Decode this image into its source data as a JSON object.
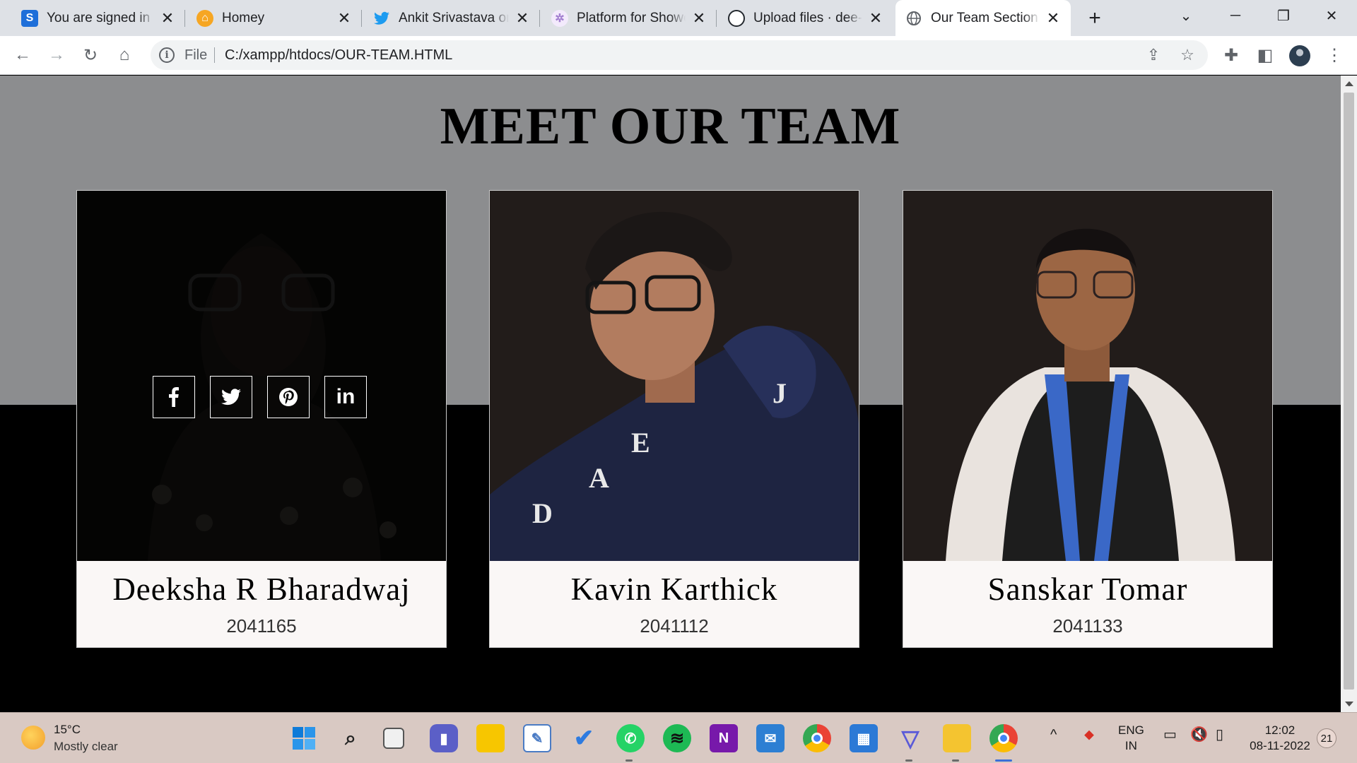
{
  "browser": {
    "tabs": [
      {
        "title": "You are signed in as",
        "favicon": "S",
        "favicon_color": "#1e6fd9"
      },
      {
        "title": "Homey",
        "favicon": "⌂",
        "favicon_color": "#f6a623"
      },
      {
        "title": "Ankit Srivastava on",
        "favicon": "🐦",
        "favicon_color": "#1d9bf0"
      },
      {
        "title": "Platform for Showc",
        "favicon": "✲",
        "favicon_color": "#c7a6e8"
      },
      {
        "title": "Upload files · dee-s",
        "favicon": "●",
        "favicon_color": "#24292f"
      },
      {
        "title": "Our Team Section",
        "favicon": "◍",
        "favicon_color": "#5f6368"
      }
    ],
    "address": {
      "scheme": "File",
      "url": "C:/xampp/htdocs/OUR-TEAM.HTML"
    }
  },
  "page": {
    "heading": "MEET OUR TEAM",
    "members": [
      {
        "name": "Deeksha R Bharadwaj",
        "roll": "2041165"
      },
      {
        "name": "Kavin Karthick",
        "roll": "2041112"
      },
      {
        "name": "Sanskar Tomar",
        "roll": "2041133"
      }
    ],
    "social_icons": [
      "facebook-icon",
      "twitter-icon",
      "pinterest-icon",
      "linkedin-icon"
    ]
  },
  "taskbar": {
    "weather": {
      "temp": "15°C",
      "desc": "Mostly clear"
    },
    "lang": {
      "line1": "ENG",
      "line2": "IN"
    },
    "clock": {
      "time": "12:02",
      "date": "08-11-2022"
    },
    "notifications": "21"
  },
  "colors": {
    "page_top": "#8c8d8f",
    "page_bottom": "#000000",
    "card_bg": "#faf7f6"
  }
}
